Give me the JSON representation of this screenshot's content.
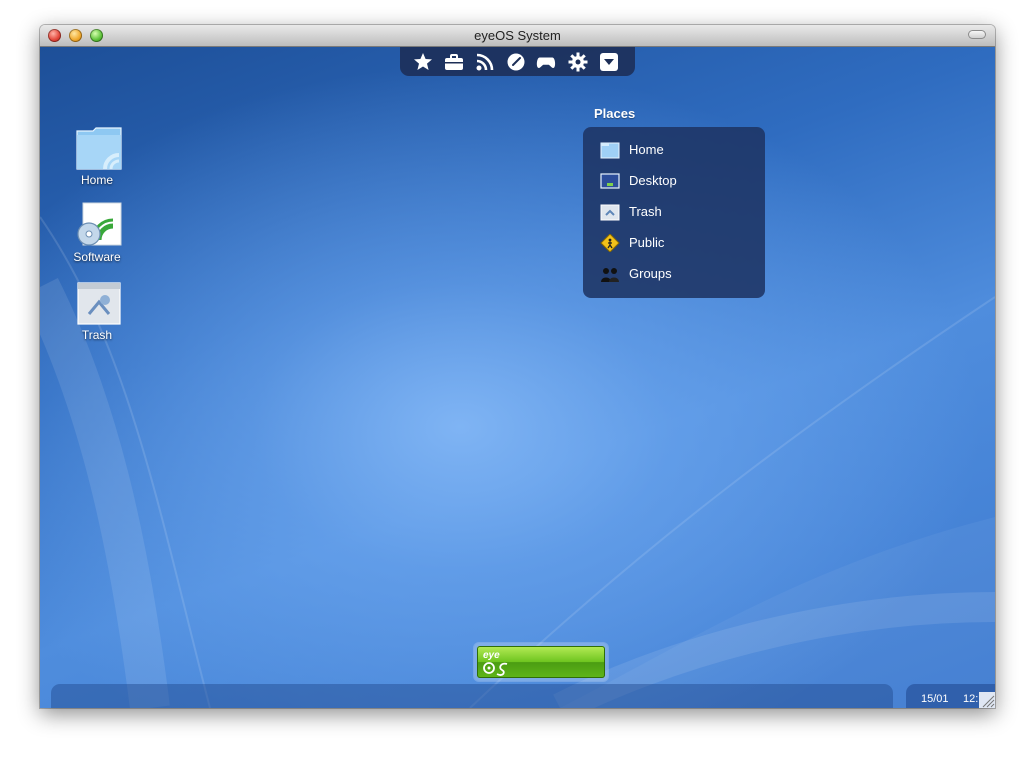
{
  "window": {
    "title": "eyeOS System"
  },
  "dock": {
    "icons": [
      "star-icon",
      "briefcase-icon",
      "rss-icon",
      "clock-icon",
      "gamepad-icon",
      "gear-icon",
      "dropdown-icon"
    ]
  },
  "places": {
    "title": "Places",
    "items": [
      {
        "label": "Home",
        "icon": "folder-icon"
      },
      {
        "label": "Desktop",
        "icon": "desktop-icon"
      },
      {
        "label": "Trash",
        "icon": "trash-icon"
      },
      {
        "label": "Public",
        "icon": "public-sign-icon"
      },
      {
        "label": "Groups",
        "icon": "groups-icon"
      }
    ]
  },
  "desktop_icons": [
    {
      "label": "Home",
      "icon": "home-folder-icon"
    },
    {
      "label": "Software",
      "icon": "software-icon"
    },
    {
      "label": "Trash",
      "icon": "trash-icon"
    }
  ],
  "launcher": {
    "logo_line1": "eye",
    "logo_line2": "OS"
  },
  "clock": {
    "date": "15/01",
    "time": "12:"
  },
  "colors": {
    "panel": "#1e3464",
    "accent_green": "#6ec41f",
    "desktop_blue": "#3d7ad0"
  }
}
